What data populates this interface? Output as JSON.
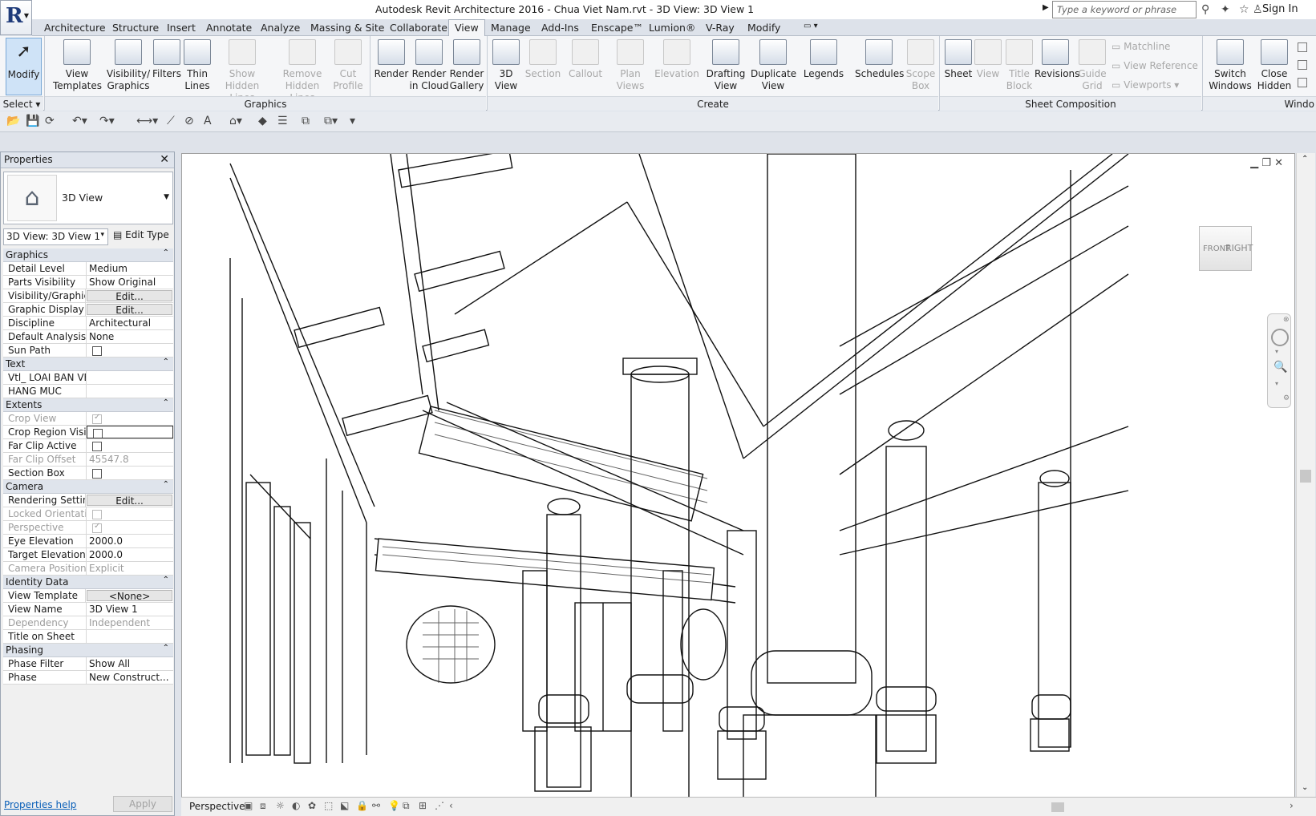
{
  "app": {
    "title": "Autodesk Revit Architecture 2016 -    Chua Viet Nam.rvt - 3D View: 3D View 1",
    "search_placeholder": "Type a keyword or phrase",
    "sign_in": "Sign In"
  },
  "tabs": [
    "Architecture",
    "Structure",
    "Insert",
    "Annotate",
    "Analyze",
    "Massing & Site",
    "Collaborate",
    "View",
    "Manage",
    "Add-Ins",
    "Enscape™",
    "Lumion®",
    "V-Ray",
    "Modify"
  ],
  "active_tab": "View",
  "ribbon": {
    "select_label": "Select",
    "modify": "Modify",
    "graphics": {
      "view_templates": [
        "View",
        "Templates"
      ],
      "visibility_graphics": [
        "Visibility/",
        "Graphics"
      ],
      "filters": "Filters",
      "thin_lines": [
        "Thin",
        "Lines"
      ],
      "show_hidden": [
        "Show",
        "Hidden Lines"
      ],
      "remove_hidden": [
        "Remove",
        "Hidden Lines"
      ],
      "cut_profile": [
        "Cut",
        "Profile"
      ],
      "panel": "Graphics"
    },
    "presentation": {
      "render": "Render",
      "render_cloud": [
        "Render",
        "in Cloud"
      ],
      "render_gallery": [
        "Render",
        "Gallery"
      ]
    },
    "create": {
      "view_3d": [
        "3D",
        "View"
      ],
      "section": "Section",
      "callout": "Callout",
      "plan_views": [
        "Plan",
        "Views"
      ],
      "elevation": "Elevation",
      "drafting_view": [
        "Drafting",
        "View"
      ],
      "duplicate_view": [
        "Duplicate",
        "View"
      ],
      "legends": "Legends",
      "schedules": "Schedules",
      "scope_box": [
        "Scope",
        "Box"
      ],
      "panel": "Create"
    },
    "sheet": {
      "sheet": "Sheet",
      "view": "View",
      "title_block": [
        "Title",
        "Block"
      ],
      "revisions": "Revisions",
      "guide_grid": [
        "Guide",
        "Grid"
      ],
      "matchline": "Matchline",
      "view_reference": "View  Reference",
      "viewports": "Viewports",
      "panel": "Sheet Composition"
    },
    "windows": {
      "switch_windows": [
        "Switch",
        "Windows"
      ],
      "close_hidden": [
        "Close",
        "Hidden"
      ],
      "panel": "Windo"
    }
  },
  "properties": {
    "title": "Properties",
    "type_name": "3D View",
    "instance_selector": "3D View: 3D View 1",
    "edit_type": "Edit Type",
    "sections": [
      {
        "name": "Graphics",
        "rows": [
          {
            "k": "Detail Level",
            "v": "Medium"
          },
          {
            "k": "Parts Visibility",
            "v": "Show Original"
          },
          {
            "k": "Visibility/Graphic...",
            "v": "Edit...",
            "btn": true
          },
          {
            "k": "Graphic Display ...",
            "v": "Edit...",
            "btn": true
          },
          {
            "k": "Discipline",
            "v": "Architectural"
          },
          {
            "k": "Default Analysis ...",
            "v": "None"
          },
          {
            "k": "Sun Path",
            "cb": false
          }
        ]
      },
      {
        "name": "Text",
        "rows": [
          {
            "k": "Vtl_ LOAI BAN VE",
            "v": ""
          },
          {
            "k": "HANG MUC",
            "v": ""
          }
        ]
      },
      {
        "name": "Extents",
        "rows": [
          {
            "k": "Crop View",
            "cb": true,
            "dis": true
          },
          {
            "k": "Crop Region Visi...",
            "cb": false,
            "hl": true
          },
          {
            "k": "Far Clip Active",
            "cb": false
          },
          {
            "k": "Far Clip Offset",
            "v": "45547.8",
            "dis": true
          },
          {
            "k": "Section Box",
            "cb": false
          }
        ]
      },
      {
        "name": "Camera",
        "rows": [
          {
            "k": "Rendering Settings",
            "v": "Edit...",
            "btn": true
          },
          {
            "k": "Locked Orientati...",
            "cb": false,
            "dis": true
          },
          {
            "k": "Perspective",
            "cb": true,
            "dis": true
          },
          {
            "k": "Eye Elevation",
            "v": "2000.0"
          },
          {
            "k": "Target Elevation",
            "v": "2000.0"
          },
          {
            "k": "Camera Position",
            "v": "Explicit",
            "dis": true
          }
        ]
      },
      {
        "name": "Identity Data",
        "rows": [
          {
            "k": "View Template",
            "v": "<None>",
            "btn": true
          },
          {
            "k": "View Name",
            "v": "3D View 1"
          },
          {
            "k": "Dependency",
            "v": "Independent",
            "dis": true
          },
          {
            "k": "Title on Sheet",
            "v": ""
          }
        ]
      },
      {
        "name": "Phasing",
        "rows": [
          {
            "k": "Phase Filter",
            "v": "Show All"
          },
          {
            "k": "Phase",
            "v": "New Construct..."
          }
        ]
      }
    ],
    "help": "Properties help",
    "apply": "Apply"
  },
  "viewcube": {
    "front": "FRONT",
    "right": "RIGHT"
  },
  "viewbar": {
    "label": "Perspective"
  }
}
